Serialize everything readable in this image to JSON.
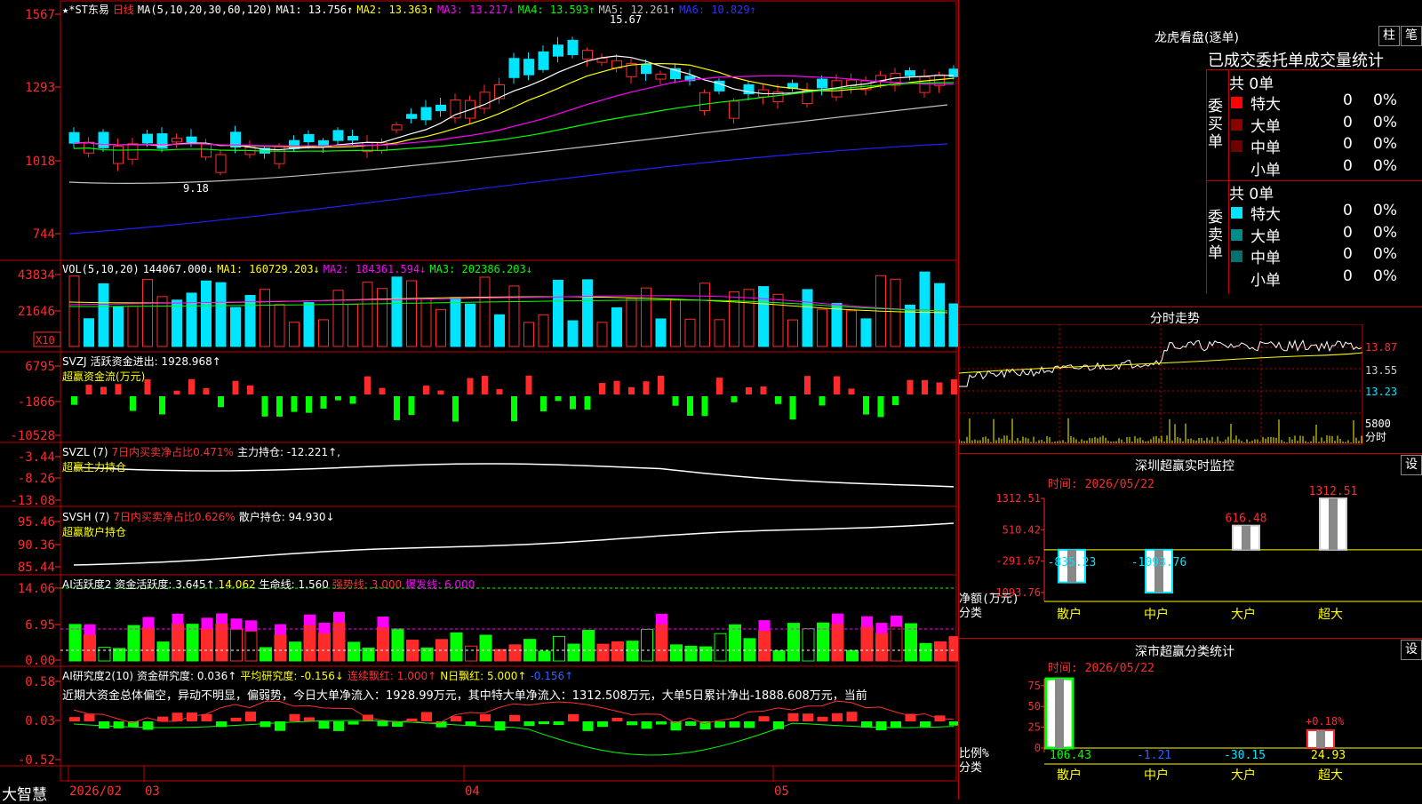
{
  "colors": {
    "up": "#ff2a2a",
    "down": "#00e5ff",
    "grid": "#c00000",
    "white": "#ffffff",
    "yellow": "#ffff00",
    "magenta": "#ff00ff",
    "green": "#00ff00",
    "gray": "#c0c0c0",
    "blue": "#1a1aff"
  },
  "kline": {
    "title": "★*ST东易",
    "period": "日线",
    "ma_caption": "MA(5,10,20,30,60,120)",
    "ma": [
      {
        "label": "MA1: 13.756↑",
        "color": "#ffffff"
      },
      {
        "label": "MA2: 13.363↑",
        "color": "#ffff00"
      },
      {
        "label": "MA3: 13.217↓",
        "color": "#ff00ff"
      },
      {
        "label": "MA4: 13.593↑",
        "color": "#00ff00"
      },
      {
        "label": "MA5: 12.261↑",
        "color": "#c0c0c0"
      },
      {
        "label": "MA6: 10.829↑",
        "color": "#3030ff"
      }
    ],
    "yticks": [
      "1567",
      "1293",
      "1018",
      "744"
    ],
    "high_label": "15.67",
    "low_label": "9.18"
  },
  "vol": {
    "caption": "VOL(5,10,20)",
    "value": "144067.000↓",
    "ma": [
      {
        "label": "MA1: 160729.203↓",
        "color": "#ffff00"
      },
      {
        "label": "MA2: 184361.594↓",
        "color": "#ff00ff"
      },
      {
        "label": "MA3: 202386.203↓",
        "color": "#00ff00"
      }
    ],
    "yticks": [
      "43834",
      "21646"
    ],
    "unit": "X10"
  },
  "svzj": {
    "caption": "SVZJ",
    "label": "活跃资金进出: 1928.968↑",
    "sub": "超赢资金流(万元)",
    "yticks": [
      "6795",
      "-1866",
      "-10528"
    ]
  },
  "svzl": {
    "caption": "SVZL (7)",
    "label1": "7日内买卖净占比0.471%",
    "label2": "主力持仓: -12.221↑,",
    "sub": "超赢主力持仓",
    "yticks": [
      "-3.44",
      "-8.26",
      "-13.08"
    ]
  },
  "svsh": {
    "caption": "SVSH (7)",
    "label1": "7日内买卖净占比0.626%",
    "label2": "散户持仓: 94.930↓",
    "sub": "超赢散户持仓",
    "yticks": [
      "95.46",
      "90.36",
      "85.44"
    ]
  },
  "ai1": {
    "caption": "AI活跃度2",
    "label1": "资金活跃度: 3.645↑",
    "label2": "14.062",
    "label3": "生命线: 1.560",
    "label4": "强势线: 3.000",
    "label5": "爆发线: 6.000",
    "yticks": [
      "14.06",
      "6.95",
      "0.00"
    ]
  },
  "ai2": {
    "caption": "AI研究度2(10)",
    "label1": "资金研究度: 0.036↑",
    "label2": "平均研究度: -0.156↓",
    "label3": "连续飘红: 1.000↑",
    "label4": "N日飘红: 5.000↑",
    "label5": "-0.156↑",
    "text": "近期大资金总体偏空，异动不明显，偏弱势，今日大单净流入：1928.99万元，其中特大单净流入：1312.508万元，大单5日累计净出-1888.608万元，当前",
    "yticks": [
      "0.58",
      "0.03",
      "-0.52"
    ]
  },
  "bottom": {
    "brand": "大智慧",
    "dates": [
      "2026/02",
      "03",
      "04",
      "05"
    ]
  },
  "lhb": {
    "title": "龙虎看盘(逐单)",
    "btn1": "柱",
    "btn2": "笔",
    "heading": "已成交委托单成交量统计",
    "buy_side": "委买单",
    "sell_side": "委卖单",
    "buy_total": "共 0单",
    "sell_total": "共 0单",
    "buy_rows": [
      {
        "label": "特大",
        "count": "0",
        "pct": "0%",
        "color": "#ff0000"
      },
      {
        "label": "大单",
        "count": "0",
        "pct": "0%",
        "color": "#8b0000"
      },
      {
        "label": "中单",
        "count": "0",
        "pct": "0%",
        "color": "#6e0000"
      },
      {
        "label": "小单",
        "count": "0",
        "pct": "0%",
        "color": ""
      }
    ],
    "sell_rows": [
      {
        "label": "特大",
        "count": "0",
        "pct": "0%",
        "color": "#00e5ff"
      },
      {
        "label": "大单",
        "count": "0",
        "pct": "0%",
        "color": "#008b8b"
      },
      {
        "label": "中单",
        "count": "0",
        "pct": "0%",
        "color": "#007070"
      },
      {
        "label": "小单",
        "count": "0",
        "pct": "0%",
        "color": ""
      }
    ]
  },
  "fenshi": {
    "title": "分时走势",
    "yticks": [
      "13.87",
      "13.55",
      "13.23"
    ],
    "vol_tick": "5800",
    "vol_unit": "分时"
  },
  "monitor": {
    "title": "深圳超赢实时监控",
    "btn": "设",
    "time": "时间: 2026/05/22",
    "yticks": [
      "1312.51",
      "510.42",
      "-291.67",
      "-1093.76"
    ],
    "ylabel1": "净额(万元)",
    "ylabel2": "分类",
    "bars": [
      {
        "cat": "散户",
        "value": -835.23,
        "label": "-835.23"
      },
      {
        "cat": "中户",
        "value": -1093.76,
        "label": "-1093.76"
      },
      {
        "cat": "大户",
        "value": 616.48,
        "label": "616.48"
      },
      {
        "cat": "超大",
        "value": 1312.51,
        "label": "1312.51"
      }
    ]
  },
  "classify": {
    "title": "深市超赢分类统计",
    "btn": "设",
    "time": "时间: 2026/05/22",
    "yticks": [
      "75",
      "50",
      "25",
      "0"
    ],
    "ylabel1": "比例%",
    "ylabel2": "分类",
    "cats": [
      "散户",
      "中户",
      "大户",
      "超大"
    ],
    "values": [
      {
        "label": "106.43",
        "color": "#00ff00"
      },
      {
        "label": "-1.21",
        "color": "#3060ff"
      },
      {
        "label": "-30.15",
        "color": "#00e5ff"
      },
      {
        "label": "24.93",
        "color": "#ffff00"
      }
    ],
    "extra_label": "+0.18%"
  }
}
